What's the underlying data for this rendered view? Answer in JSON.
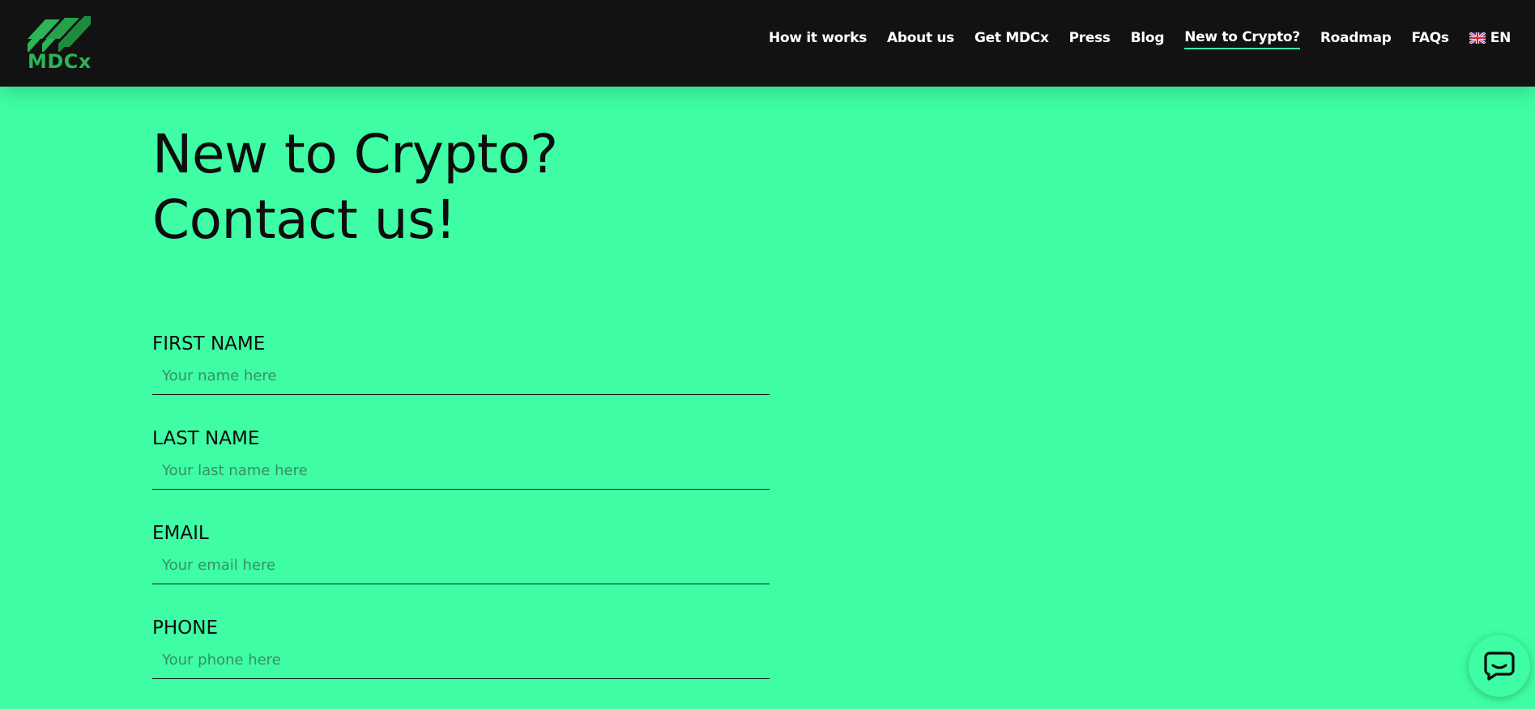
{
  "header": {
    "logo_text": "MDCx",
    "nav": [
      {
        "label": "How it works",
        "active": false
      },
      {
        "label": "About us",
        "active": false
      },
      {
        "label": "Get MDCx",
        "active": false
      },
      {
        "label": "Press",
        "active": false
      },
      {
        "label": "Blog",
        "active": false
      },
      {
        "label": "New to Crypto?",
        "active": true
      },
      {
        "label": "Roadmap",
        "active": false
      },
      {
        "label": "FAQs",
        "active": false
      }
    ],
    "language": {
      "label": "EN",
      "icon": "uk-flag-icon"
    }
  },
  "page": {
    "title": "New to Crypto? Contact us!"
  },
  "form": {
    "fields": [
      {
        "label": "FIRST NAME",
        "placeholder": "Your name here",
        "value": ""
      },
      {
        "label": "LAST NAME",
        "placeholder": "Your last name here",
        "value": ""
      },
      {
        "label": "EMAIL",
        "placeholder": "Your email here",
        "value": ""
      },
      {
        "label": "PHONE",
        "placeholder": "Your phone here",
        "value": ""
      }
    ]
  },
  "chat": {
    "icon": "chat-bubble-icon"
  },
  "colors": {
    "background": "#3efda4",
    "header": "#121212",
    "brand_green": "#2bb556",
    "text": "#0d0d0d"
  }
}
